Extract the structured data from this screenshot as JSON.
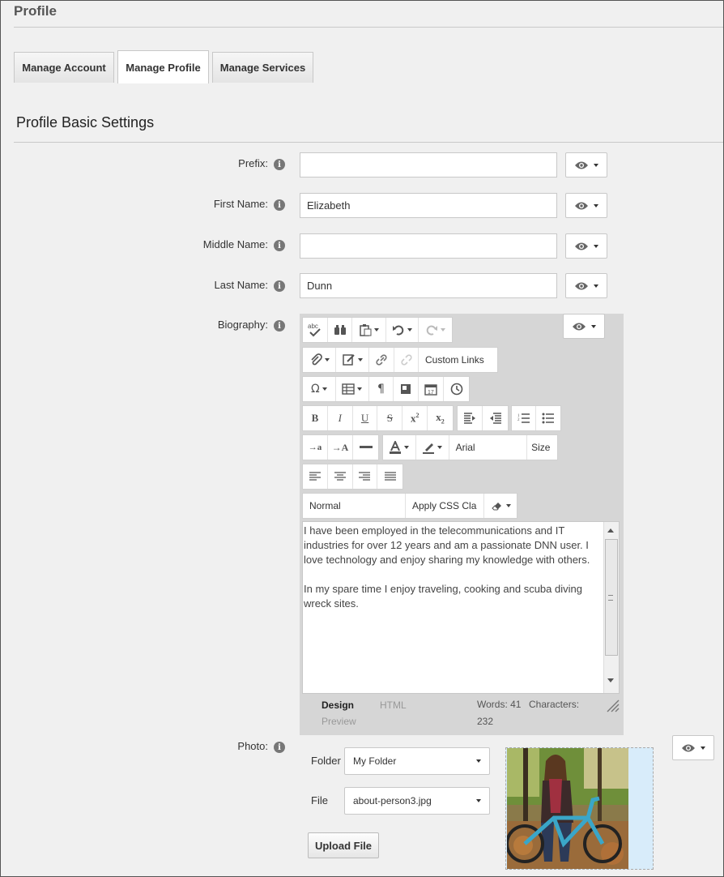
{
  "header": {
    "title": "Profile"
  },
  "tabs": [
    {
      "label": "Manage Account"
    },
    {
      "label": "Manage Profile"
    },
    {
      "label": "Manage Services"
    }
  ],
  "section": {
    "title": "Profile Basic Settings"
  },
  "fields": {
    "prefix": {
      "label": "Prefix:",
      "value": ""
    },
    "first_name": {
      "label": "First Name:",
      "value": "Elizabeth"
    },
    "middle_name": {
      "label": "Middle Name:",
      "value": ""
    },
    "last_name": {
      "label": "Last Name:",
      "value": "Dunn"
    },
    "biography": {
      "label": "Biography:"
    },
    "photo": {
      "label": "Photo:"
    }
  },
  "editor": {
    "toolbar": {
      "custom_links": "Custom Links",
      "font_name": "Arial",
      "font_size": "Size",
      "paragraph_format": "Normal",
      "css_class": "Apply CSS Cla"
    },
    "content": [
      "I have been employed in the telecommunications and IT industries for over 12 years and am a passionate DNN user. I love technology and  enjoy sharing my knowledge with others.",
      "In my spare time I enjoy traveling, cooking and scuba diving wreck sites."
    ],
    "modes": {
      "design": "Design",
      "html": "HTML",
      "preview": "Preview"
    },
    "stats": {
      "words": "Words: 41",
      "characters": "Characters:",
      "characters_count": "232"
    }
  },
  "photo": {
    "folder_label": "Folder",
    "folder_value": "My Folder",
    "file_label": "File",
    "file_value": "about-person3.jpg",
    "upload_label": "Upload File"
  },
  "colors": {
    "accent": "#555555",
    "background": "#f0f0f0",
    "border": "#c8c8c8"
  }
}
